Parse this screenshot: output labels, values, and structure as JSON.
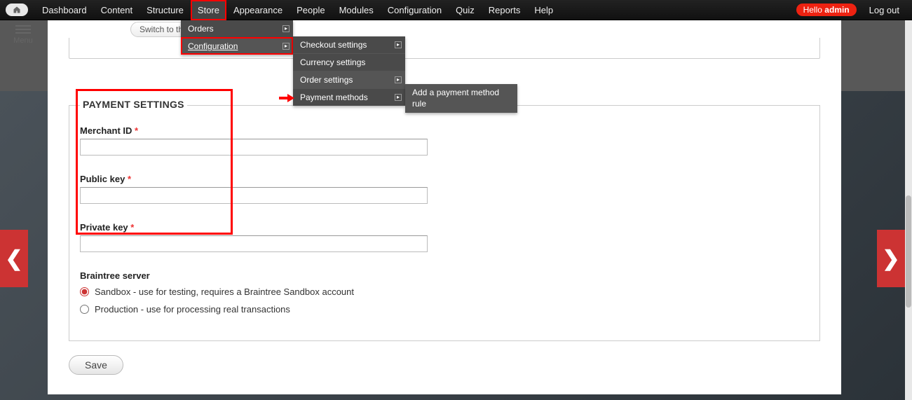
{
  "toolbar": {
    "items": [
      "Dashboard",
      "Content",
      "Structure",
      "Store",
      "Appearance",
      "People",
      "Modules",
      "Configuration",
      "Quiz",
      "Reports",
      "Help"
    ],
    "hello_prefix": "Hello ",
    "hello_user": "admin",
    "logout": "Log out"
  },
  "menu_store": {
    "orders": "Orders",
    "configuration": "Configuration"
  },
  "menu_config": {
    "checkout": "Checkout settings",
    "currency": "Currency settings",
    "order": "Order settings",
    "payment": "Payment methods"
  },
  "menu_payment": {
    "add_rule": "Add a payment method rule"
  },
  "page": {
    "menu_label": "Menu",
    "switch_direct": "Switch to the direct input"
  },
  "fieldset": {
    "legend": "PAYMENT SETTINGS",
    "merchant_id_label": "Merchant ID",
    "merchant_id_value": "",
    "public_key_label": "Public key",
    "public_key_value": "",
    "private_key_label": "Private key",
    "private_key_value": "",
    "required_marker": "*",
    "server_label": "Braintree server",
    "sandbox_label": "Sandbox - use for testing, requires a Braintree Sandbox account",
    "production_label": "Production - use for processing real transactions"
  },
  "actions": {
    "save": "Save"
  }
}
